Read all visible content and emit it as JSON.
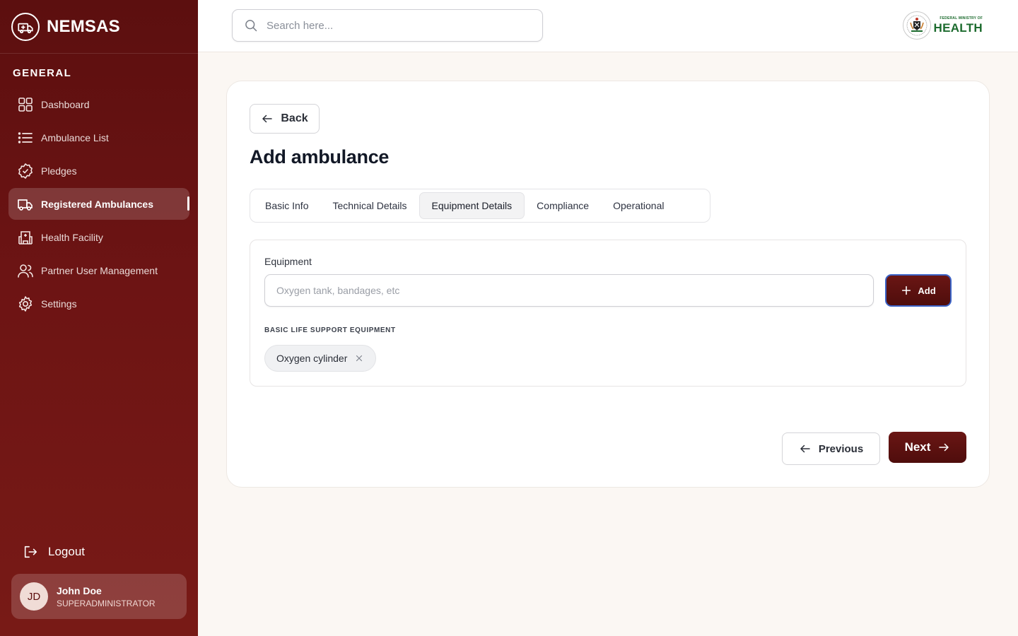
{
  "brand": {
    "name": "NEMSAS",
    "logo_icon": "ambulance-logo-icon"
  },
  "sidebar": {
    "section_label": "GENERAL",
    "items": [
      {
        "label": "Dashboard",
        "icon": "grid-icon",
        "active": false
      },
      {
        "label": "Ambulance List",
        "icon": "list-icon",
        "active": false
      },
      {
        "label": "Pledges",
        "icon": "badge-check-icon",
        "active": false
      },
      {
        "label": "Registered Ambulances",
        "icon": "truck-icon",
        "active": true
      },
      {
        "label": "Health Facility",
        "icon": "hospital-icon",
        "active": false
      },
      {
        "label": "Partner User Management",
        "icon": "users-icon",
        "active": false
      },
      {
        "label": "Settings",
        "icon": "gear-icon",
        "active": false
      }
    ],
    "logout_label": "Logout",
    "user": {
      "initials": "JD",
      "name": "John Doe",
      "role": "SUPERADMINISTRATOR"
    }
  },
  "header": {
    "search_placeholder": "Search here...",
    "ministry_small": "FEDERAL MINISTRY OF",
    "ministry_big": "HEALTH"
  },
  "main": {
    "back_label": "Back",
    "title": "Add ambulance",
    "tabs": [
      {
        "label": "Basic Info",
        "active": false
      },
      {
        "label": "Technical Details",
        "active": false
      },
      {
        "label": "Equipment Details",
        "active": true
      },
      {
        "label": "Compliance",
        "active": false
      },
      {
        "label": "Operational",
        "active": false
      }
    ],
    "equipment": {
      "label": "Equipment",
      "placeholder": "Oxygen tank, bandages, etc",
      "value": "",
      "add_label": "Add",
      "category_title": "BASIC LIFE SUPPORT EQUIPMENT",
      "items": [
        "Oxygen cylinder"
      ]
    },
    "previous_label": "Previous",
    "next_label": "Next"
  },
  "colors": {
    "sidebar_bg": "#6d1414",
    "primary_button": "#5c0f0f",
    "page_bg": "#fbf7f3",
    "ministry_green": "#1c6b2e"
  }
}
